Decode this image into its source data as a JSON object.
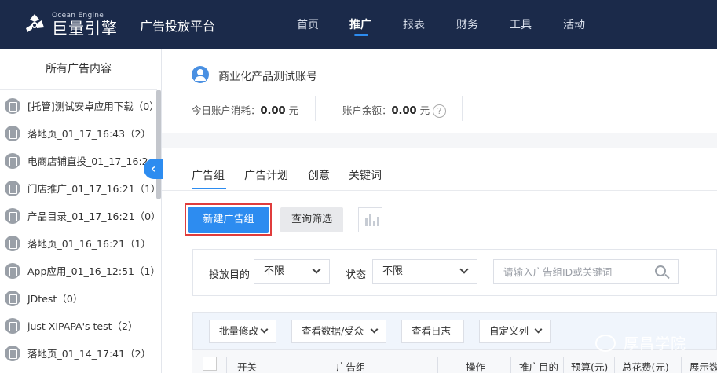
{
  "nav": {
    "logo_en": "Ocean Engine",
    "logo_cn": "巨量引擎",
    "platform_title": "广告投放平台",
    "items": [
      {
        "label": "首页"
      },
      {
        "label": "推广"
      },
      {
        "label": "报表"
      },
      {
        "label": "财务"
      },
      {
        "label": "工具"
      },
      {
        "label": "活动"
      }
    ],
    "active": "推广"
  },
  "sidebar": {
    "title": "所有广告内容",
    "items": [
      {
        "label": "[托管]测试安卓应用下载（0）",
        "icon": "android-icon"
      },
      {
        "label": "落地页_01_17_16:43（2）",
        "icon": "landing-page-icon"
      },
      {
        "label": "电商店铺直投_01_17_16:2...",
        "icon": "shop-icon"
      },
      {
        "label": "门店推广_01_17_16:21（1）",
        "icon": "store-icon"
      },
      {
        "label": "产品目录_01_17_16:21（0）",
        "icon": "catalog-icon"
      },
      {
        "label": "落地页_01_16_16:21（1）",
        "icon": "landing-page-icon"
      },
      {
        "label": "App应用_01_16_12:51（1）",
        "icon": "android-icon"
      },
      {
        "label": "JDtest（0）",
        "icon": "landing-page-icon"
      },
      {
        "label": "just XIPAPA's test（2）",
        "icon": "landing-page-icon"
      },
      {
        "label": "落地页_01_14_17:41（2）",
        "icon": "landing-page-icon"
      }
    ]
  },
  "account": {
    "name": "商业化产品测试账号",
    "today_cost_label": "今日账户消耗：",
    "today_cost_value": "0.00",
    "today_cost_unit": "元",
    "balance_label": "账户余额：",
    "balance_value": "0.00",
    "balance_unit": "元",
    "help_glyph": "?"
  },
  "tabs": [
    {
      "label": "广告组"
    },
    {
      "label": "广告计划"
    },
    {
      "label": "创意"
    },
    {
      "label": "关键词"
    }
  ],
  "actions": {
    "new_group": "新建广告组",
    "query_filter": "查询筛选"
  },
  "filters": {
    "purpose_label": "投放目的",
    "purpose_value": "不限",
    "status_label": "状态",
    "status_value": "不限",
    "search_placeholder": "请输入广告组ID或关键词"
  },
  "toolbar": {
    "batch_edit": "批量修改",
    "view_data": "查看数据/受众",
    "view_log": "查看日志",
    "custom_columns": "自定义列"
  },
  "table": {
    "columns": [
      "开关",
      "广告组",
      "操作",
      "推广目的",
      "预算(元)",
      "总花费(元)",
      "展示数"
    ]
  },
  "watermark": "厚昌学院",
  "colors": {
    "nav_bg": "#1b2a4a",
    "primary": "#2d8cf0",
    "highlight_frame": "#e03c3c"
  }
}
